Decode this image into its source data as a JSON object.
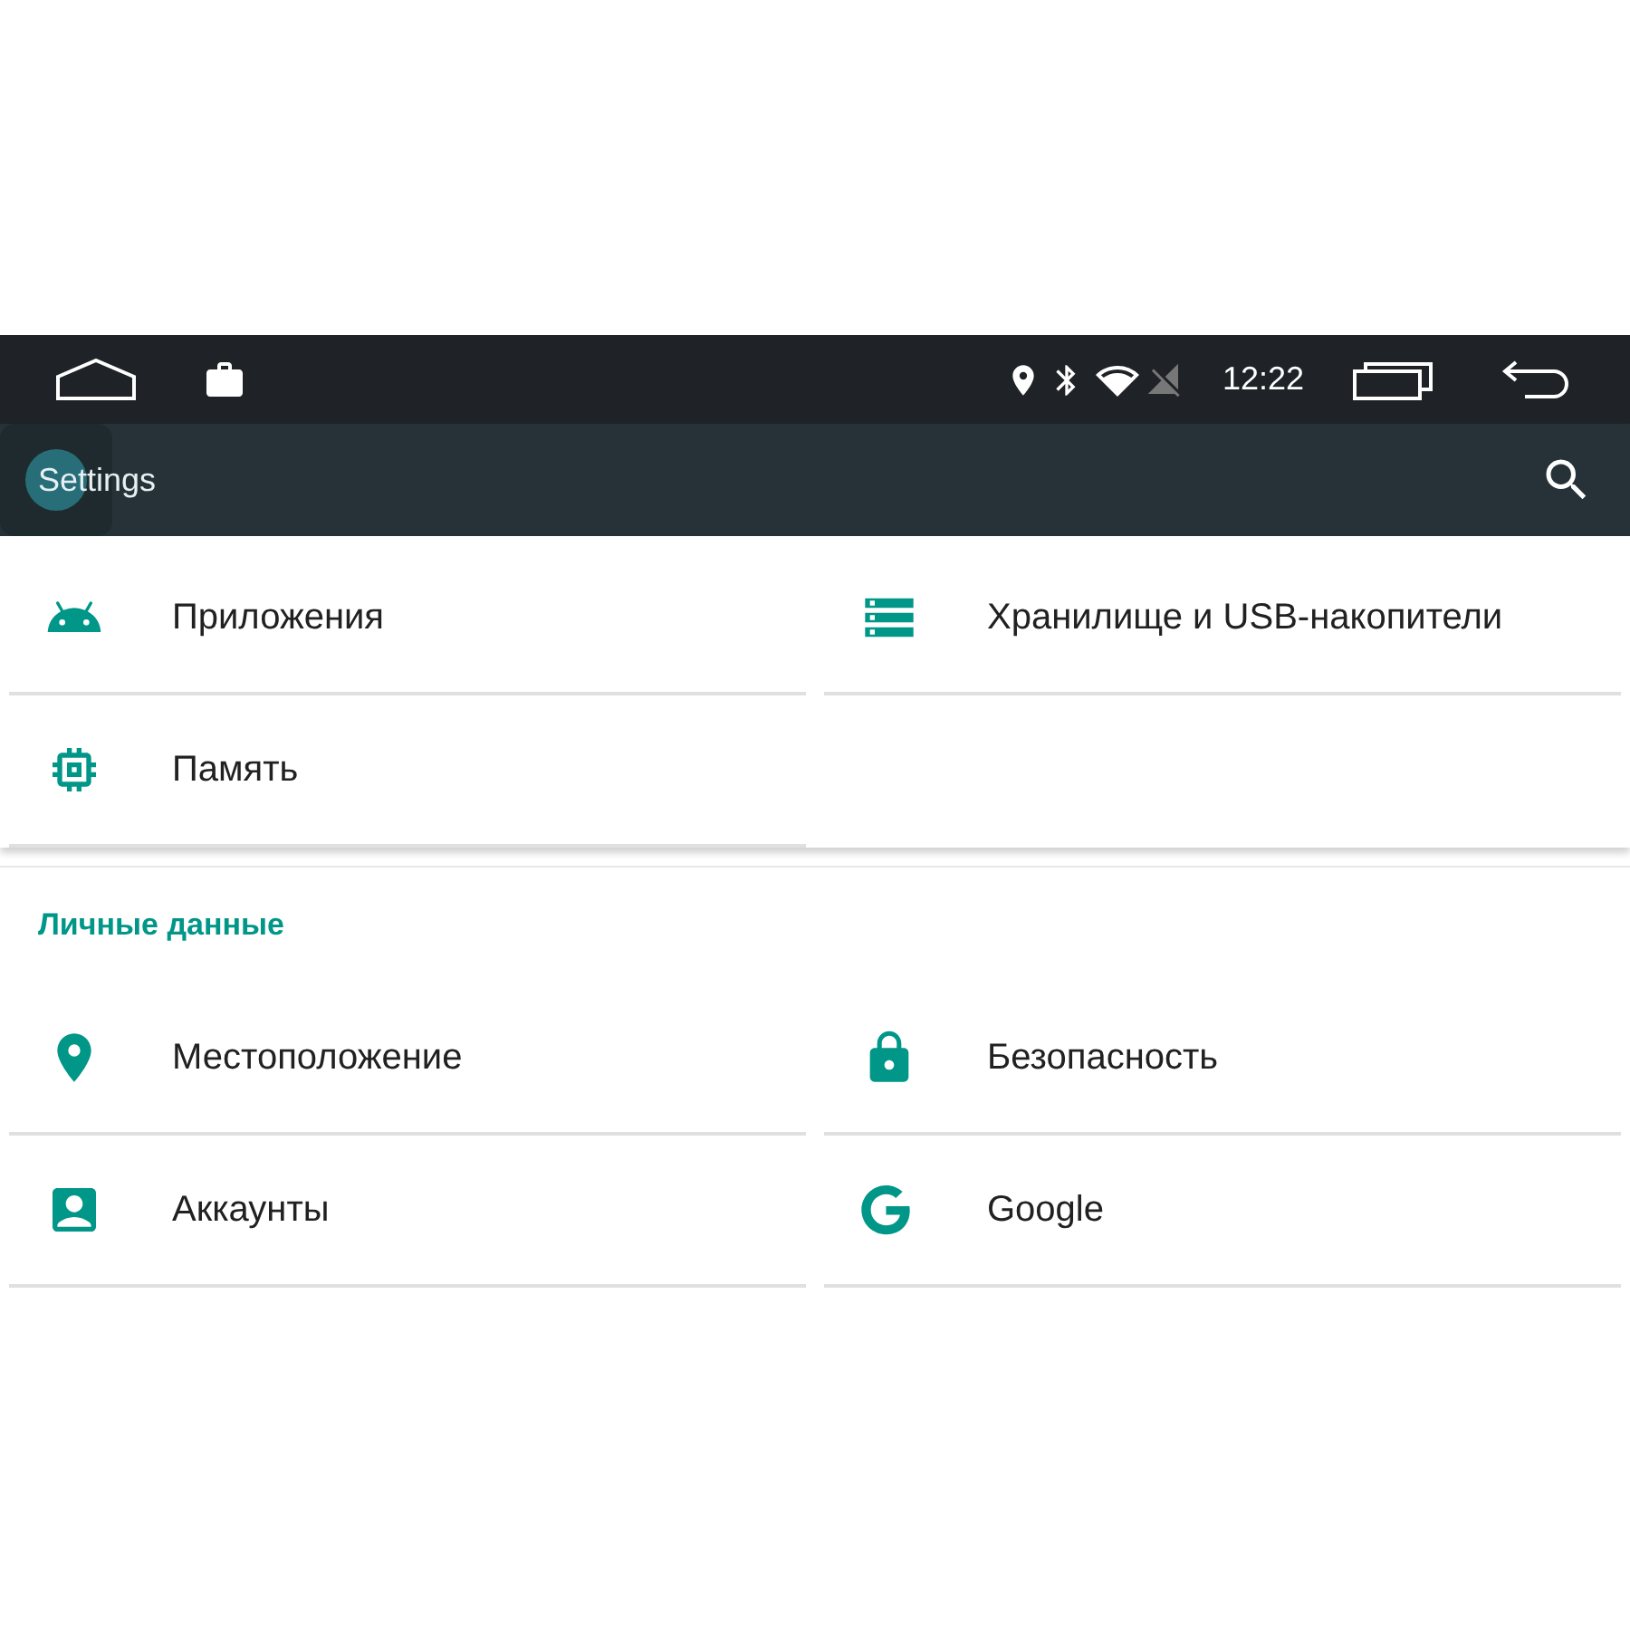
{
  "status_bar": {
    "time": "12:22"
  },
  "app_bar": {
    "title": "Settings"
  },
  "sections": [
    {
      "items": [
        {
          "kind": "apps",
          "label": "Приложения"
        },
        {
          "kind": "storage",
          "label": "Хранилище и USB-накопители"
        },
        {
          "kind": "memory",
          "label": "Память"
        }
      ]
    },
    {
      "header": "Личные данные",
      "items": [
        {
          "kind": "location",
          "label": "Местоположение"
        },
        {
          "kind": "security",
          "label": "Безопасность"
        },
        {
          "kind": "accounts",
          "label": "Аккаунты"
        },
        {
          "kind": "google",
          "label": "Google"
        }
      ]
    }
  ]
}
